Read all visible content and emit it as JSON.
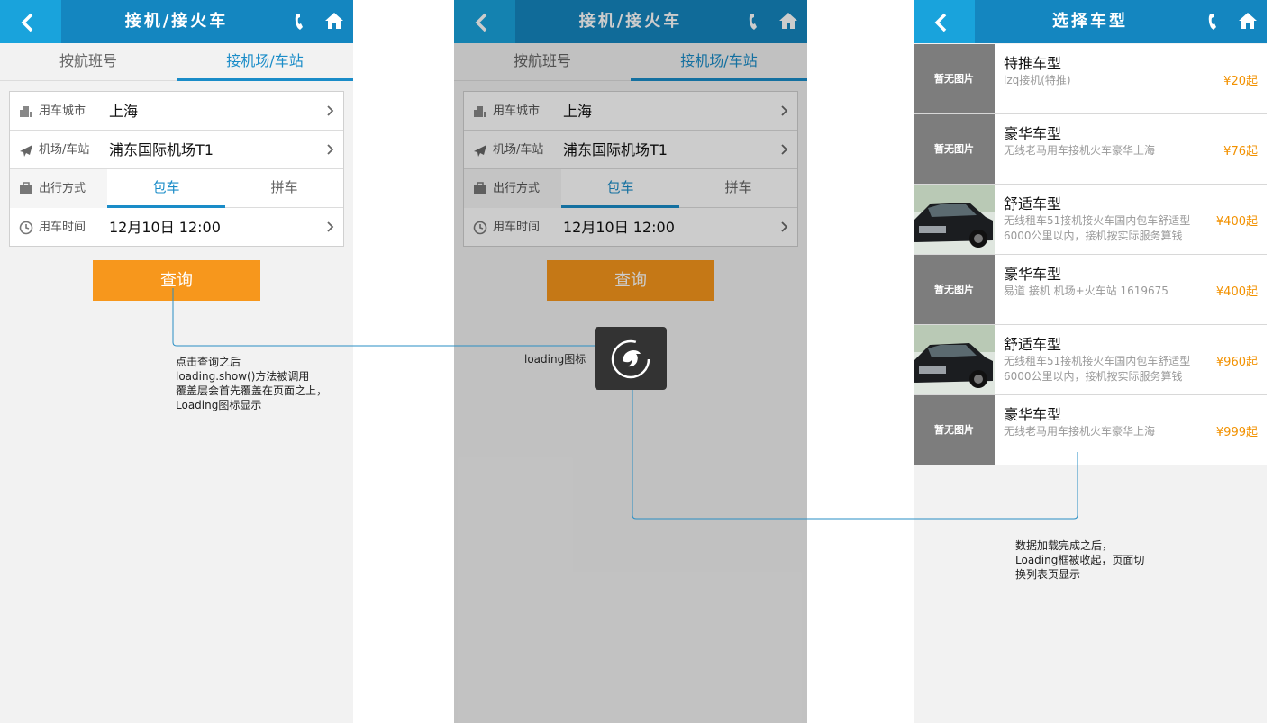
{
  "screen1": {
    "header_title": "接机/接火车",
    "tabs": [
      "按航班号",
      "接机场/车站"
    ],
    "rows": {
      "city_label": "用车城市",
      "city_value": "上海",
      "station_label": "机场/车站",
      "station_value": "浦东国际机场T1",
      "mode_label": "出行方式",
      "mode_options": [
        "包车",
        "拼车"
      ],
      "time_label": "用车时间",
      "time_value": "12月10日 12:00"
    },
    "query_button": "查询"
  },
  "screen2": {
    "header_title": "接机/接火车",
    "tabs": [
      "按航班号",
      "接机场/车站"
    ],
    "rows": {
      "city_label": "用车城市",
      "city_value": "上海",
      "station_label": "机场/车站",
      "station_value": "浦东国际机场T1",
      "mode_label": "出行方式",
      "mode_options": [
        "包车",
        "拼车"
      ],
      "time_label": "用车时间",
      "time_value": "12月10日 12:00"
    },
    "query_button": "查询",
    "loading_label": "loading图标"
  },
  "screen3": {
    "header_title": "选择车型",
    "no_image_text": "暂无图片",
    "items": [
      {
        "title": "特推车型",
        "desc": "lzq接机(特推)",
        "price": "¥20起",
        "has_photo": false
      },
      {
        "title": "豪华车型",
        "desc": "无线老马用车接机火车豪华上海",
        "price": "¥76起",
        "has_photo": false
      },
      {
        "title": "舒适车型",
        "desc": "无线租车51接机接火车国内包车舒适型6000公里以内，接机按实际服务算钱",
        "price": "¥400起",
        "has_photo": true
      },
      {
        "title": "豪华车型",
        "desc": "易道 接机 机场+火车站 1619675",
        "price": "¥400起",
        "has_photo": false
      },
      {
        "title": "舒适车型",
        "desc": "无线租车51接机接火车国内包车舒适型6000公里以内，接机按实际服务算钱",
        "price": "¥960起",
        "has_photo": true
      },
      {
        "title": "豪华车型",
        "desc": "无线老马用车接机火车豪华上海",
        "price": "¥999起",
        "has_photo": false
      }
    ]
  },
  "annotations": {
    "note1": "点击查询之后\nloading.show()方法被调用\n覆盖层会首先覆盖在页面之上，\nLoading图标显示",
    "note2": "数据加载完成之后，\nLoading框被收起，页面切\n换列表页显示"
  },
  "colors": {
    "header": "#1486c0",
    "back_button": "#19a3dc",
    "accent": "#1a8cc8",
    "query_button": "#f7971c",
    "price": "#f29100",
    "connector": "#2a8fc4"
  },
  "icons": [
    "back-arrow-icon",
    "phone-icon",
    "home-icon",
    "building-icon",
    "plane-icon",
    "luggage-icon",
    "clock-icon",
    "chevron-right-icon",
    "loading-logo-icon"
  ]
}
